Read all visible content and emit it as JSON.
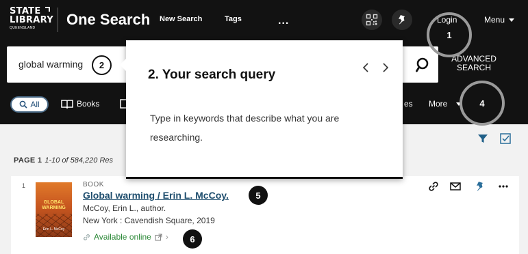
{
  "header": {
    "logo": {
      "line1": "STATE",
      "line2": "LIBRARY",
      "line3": "QUEENSLAND"
    },
    "app_title": "One Search",
    "nav": {
      "new_search": "New Search",
      "tags": "Tags",
      "more": "..."
    },
    "login": "Login",
    "menu": "Menu"
  },
  "search": {
    "query": "global warming",
    "advanced_line1": "ADVANCED",
    "advanced_line2": "SEARCH"
  },
  "filters": {
    "all": "All",
    "books": "Books",
    "partial_label": "es",
    "more": "More"
  },
  "results": {
    "page_label": "PAGE 1",
    "range_text": "1-10 of 584,220 Res",
    "items": [
      {
        "number": "1",
        "type": "BOOK",
        "title": "Global warming / Erin L. McCoy.",
        "author": "McCoy, Erin L., author.",
        "publication": "New York : Cavendish Square, 2019",
        "availability": "Available online",
        "cover": {
          "title_line1": "GLOBAL",
          "title_line2": "WARMING",
          "author": "Erin L. McCoy"
        }
      }
    ]
  },
  "tour": {
    "title": "2. Your search query",
    "body": "Type in keywords that describe what you are researching."
  },
  "markers": {
    "m1": "1",
    "m2": "2",
    "m4": "4",
    "m5": "5",
    "m6": "6"
  },
  "colors": {
    "header_bg": "#121212",
    "link_blue": "#1f4e6e",
    "available_green": "#2e8a3a",
    "accent_blue": "#2b6e9a"
  }
}
